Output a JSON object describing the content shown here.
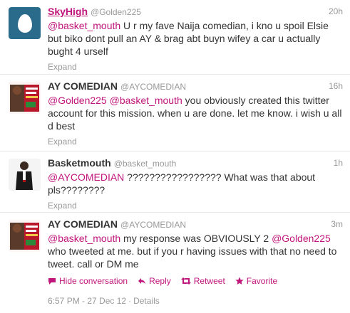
{
  "tweets": [
    {
      "fullname": "SkyHigh",
      "username": "@Golden225",
      "time": "20h",
      "text_parts": [
        {
          "type": "mention",
          "text": "@basket_mouth"
        },
        {
          "type": "text",
          "text": " U r my fave Naija comedian, i kno u spoil Elsie but biko dont pull an AY & brag abt buyn wifey a car u actually bught 4 urself"
        }
      ],
      "expand_label": "Expand",
      "avatar_icon": "egg-avatar-icon"
    },
    {
      "fullname": "AY COMEDIAN",
      "username": "@AYCOMEDIAN",
      "time": "16h",
      "text_parts": [
        {
          "type": "mention",
          "text": "@Golden225"
        },
        {
          "type": "text",
          "text": " "
        },
        {
          "type": "mention",
          "text": "@basket_mouth"
        },
        {
          "type": "text",
          "text": " you obviously created this twitter account for this mission. when u are done. let me know. i wish u all d best"
        }
      ],
      "expand_label": "Expand",
      "avatar_icon": "ay-comedian-avatar"
    },
    {
      "fullname": "Basketmouth",
      "username": "@basket_mouth",
      "time": "1h",
      "text_parts": [
        {
          "type": "mention",
          "text": "@AYCOMEDIAN"
        },
        {
          "type": "text",
          "text": " ????????????????? What was that about pls????????"
        }
      ],
      "expand_label": "Expand",
      "avatar_icon": "basketmouth-avatar"
    },
    {
      "fullname": "AY COMEDIAN",
      "username": "@AYCOMEDIAN",
      "time": "3m",
      "text_parts": [
        {
          "type": "mention",
          "text": "@basket_mouth"
        },
        {
          "type": "text",
          "text": " my response was OBVIOUSLY 2 "
        },
        {
          "type": "mention",
          "text": "@Golden225"
        },
        {
          "type": "text",
          "text": " who tweeted at me. but if you r having issues with that no need to tweet. call or DM me"
        }
      ],
      "actions": {
        "hide": "Hide conversation",
        "reply": "Reply",
        "retweet": "Retweet",
        "favorite": "Favorite"
      },
      "timestamp": "6:57 PM - 27 Dec 12",
      "details": "Details",
      "avatar_icon": "ay-comedian-avatar"
    }
  ],
  "colors": {
    "link": "#c0157b",
    "muted": "#999999",
    "text": "#333333"
  }
}
